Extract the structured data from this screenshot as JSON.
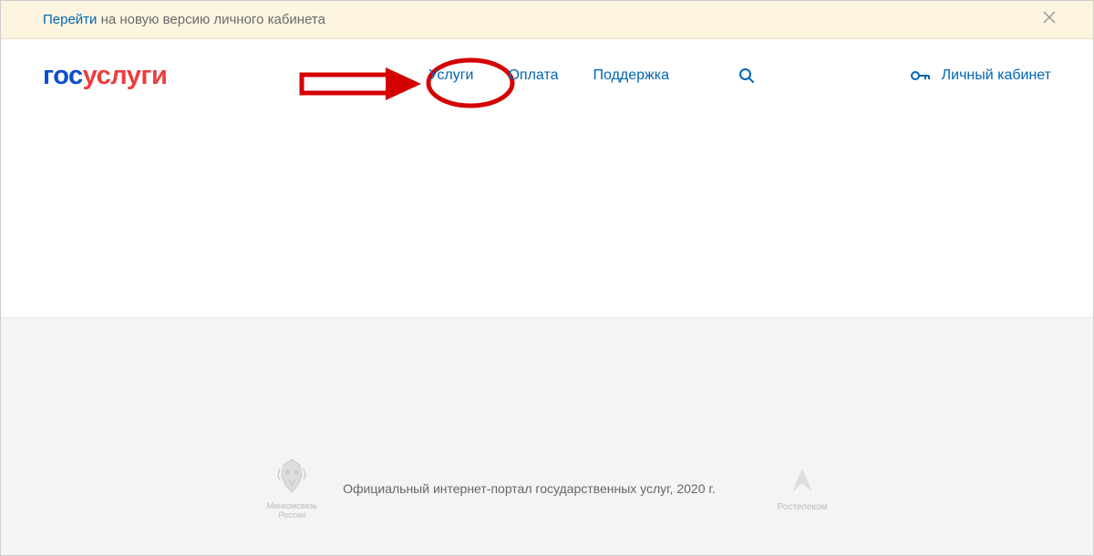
{
  "banner": {
    "link_text": "Перейти",
    "rest_text": " на новую версию личного кабинета"
  },
  "logo": {
    "gos": "гос",
    "uslugi": "услуги"
  },
  "nav": {
    "services": "Услуги",
    "payment": "Оплата",
    "support": "Поддержка"
  },
  "account": {
    "label": "Личный кабинет"
  },
  "footer": {
    "ministry_line1": "Минкомсвязь",
    "ministry_line2": "России",
    "main_text": "Официальный интернет-портал государственных услуг, 2020 г.",
    "rostelekom": "Ростелеком"
  }
}
